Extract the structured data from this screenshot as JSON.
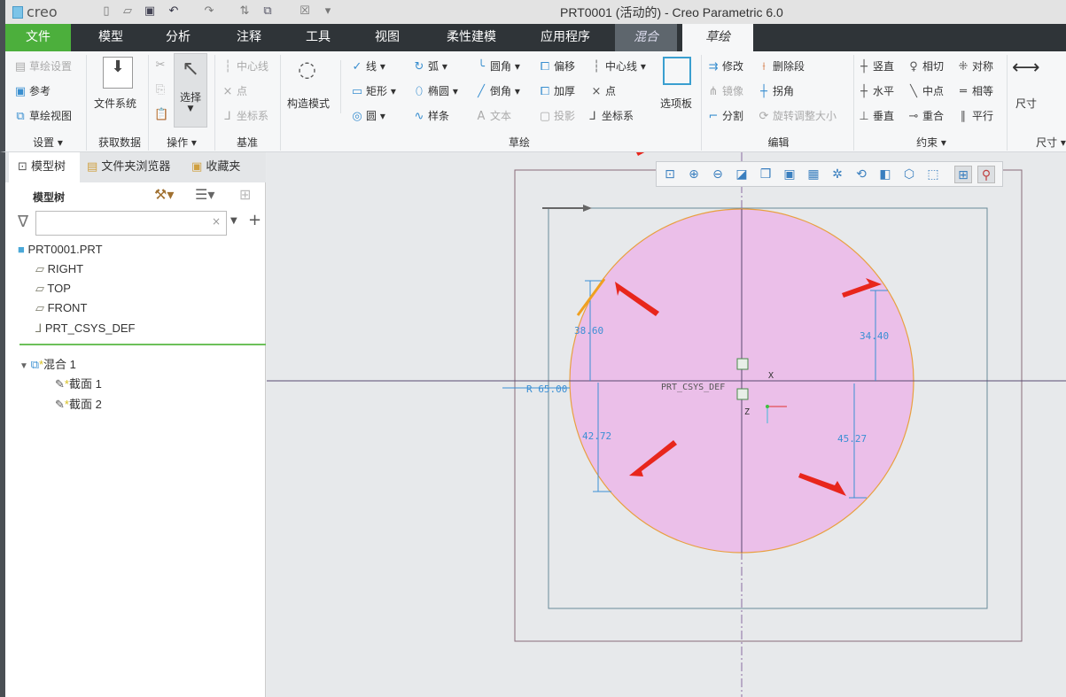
{
  "app": {
    "logo": "creo",
    "title": "PRT0001 (活动的) - Creo Parametric 6.0"
  },
  "quick_access": [
    "new-icon",
    "open-icon",
    "save-icon",
    "undo-icon",
    "redo-icon",
    "regenerate-icon",
    "windows-icon",
    "close-icon",
    "customize-icon"
  ],
  "tabs": [
    "文件",
    "模型",
    "分析",
    "注释",
    "工具",
    "视图",
    "柔性建模",
    "应用程序",
    "混合",
    "草绘"
  ],
  "ribbon": {
    "setup": {
      "items": [
        "草绘设置",
        "参考",
        "草绘视图"
      ],
      "label": "设置 ▾"
    },
    "getdata": {
      "item": "文件系统",
      "label": "获取数据"
    },
    "operations": {
      "item": "选择",
      "label": "操作 ▾"
    },
    "datum": {
      "items": [
        "中心线",
        "点",
        "坐标系"
      ],
      "label": "基准"
    },
    "construction": {
      "item": "构造模式"
    },
    "sketch": {
      "items": [
        "线 ▾",
        "弧 ▾",
        "圆角 ▾",
        "偏移",
        "中心线 ▾",
        "矩形 ▾",
        "椭圆 ▾",
        "倒角 ▾",
        "加厚",
        "点",
        "圆 ▾",
        "样条",
        "文本",
        "投影",
        "坐标系"
      ],
      "palette": "选项板",
      "label": "草绘"
    },
    "edit": {
      "items": [
        "修改",
        "删除段",
        "镜像",
        "拐角",
        "分割",
        "旋转调整大小"
      ],
      "label": "编辑"
    },
    "constrain": {
      "items": [
        "竖直",
        "相切",
        "对称",
        "水平",
        "中点",
        "相等",
        "垂直",
        "重合",
        "平行"
      ],
      "label": "约束 ▾"
    },
    "dimension": {
      "item": "尺寸",
      "label": "尺寸 ▾"
    }
  },
  "panel": {
    "tabs": [
      "模型树",
      "文件夹浏览器",
      "收藏夹"
    ],
    "header": "模型树",
    "filter_value": "",
    "tree": [
      "PRT0001.PRT",
      "RIGHT",
      "TOP",
      "FRONT",
      "PRT_CSYS_DEF",
      "混合 1",
      "截面 1",
      "截面 2"
    ]
  },
  "sketch": {
    "dims": [
      "38.60",
      "34.40",
      "42.72",
      "45.27",
      "R 65.00"
    ],
    "csys_label": "PRT_CSYS_DEF",
    "axis_x": "X",
    "axis_z": "Z",
    "colors": {
      "fill": "#ebbfe9",
      "outline": "#e8a040",
      "dim": "#3b8fd4",
      "arrow": "#e8261c"
    }
  }
}
